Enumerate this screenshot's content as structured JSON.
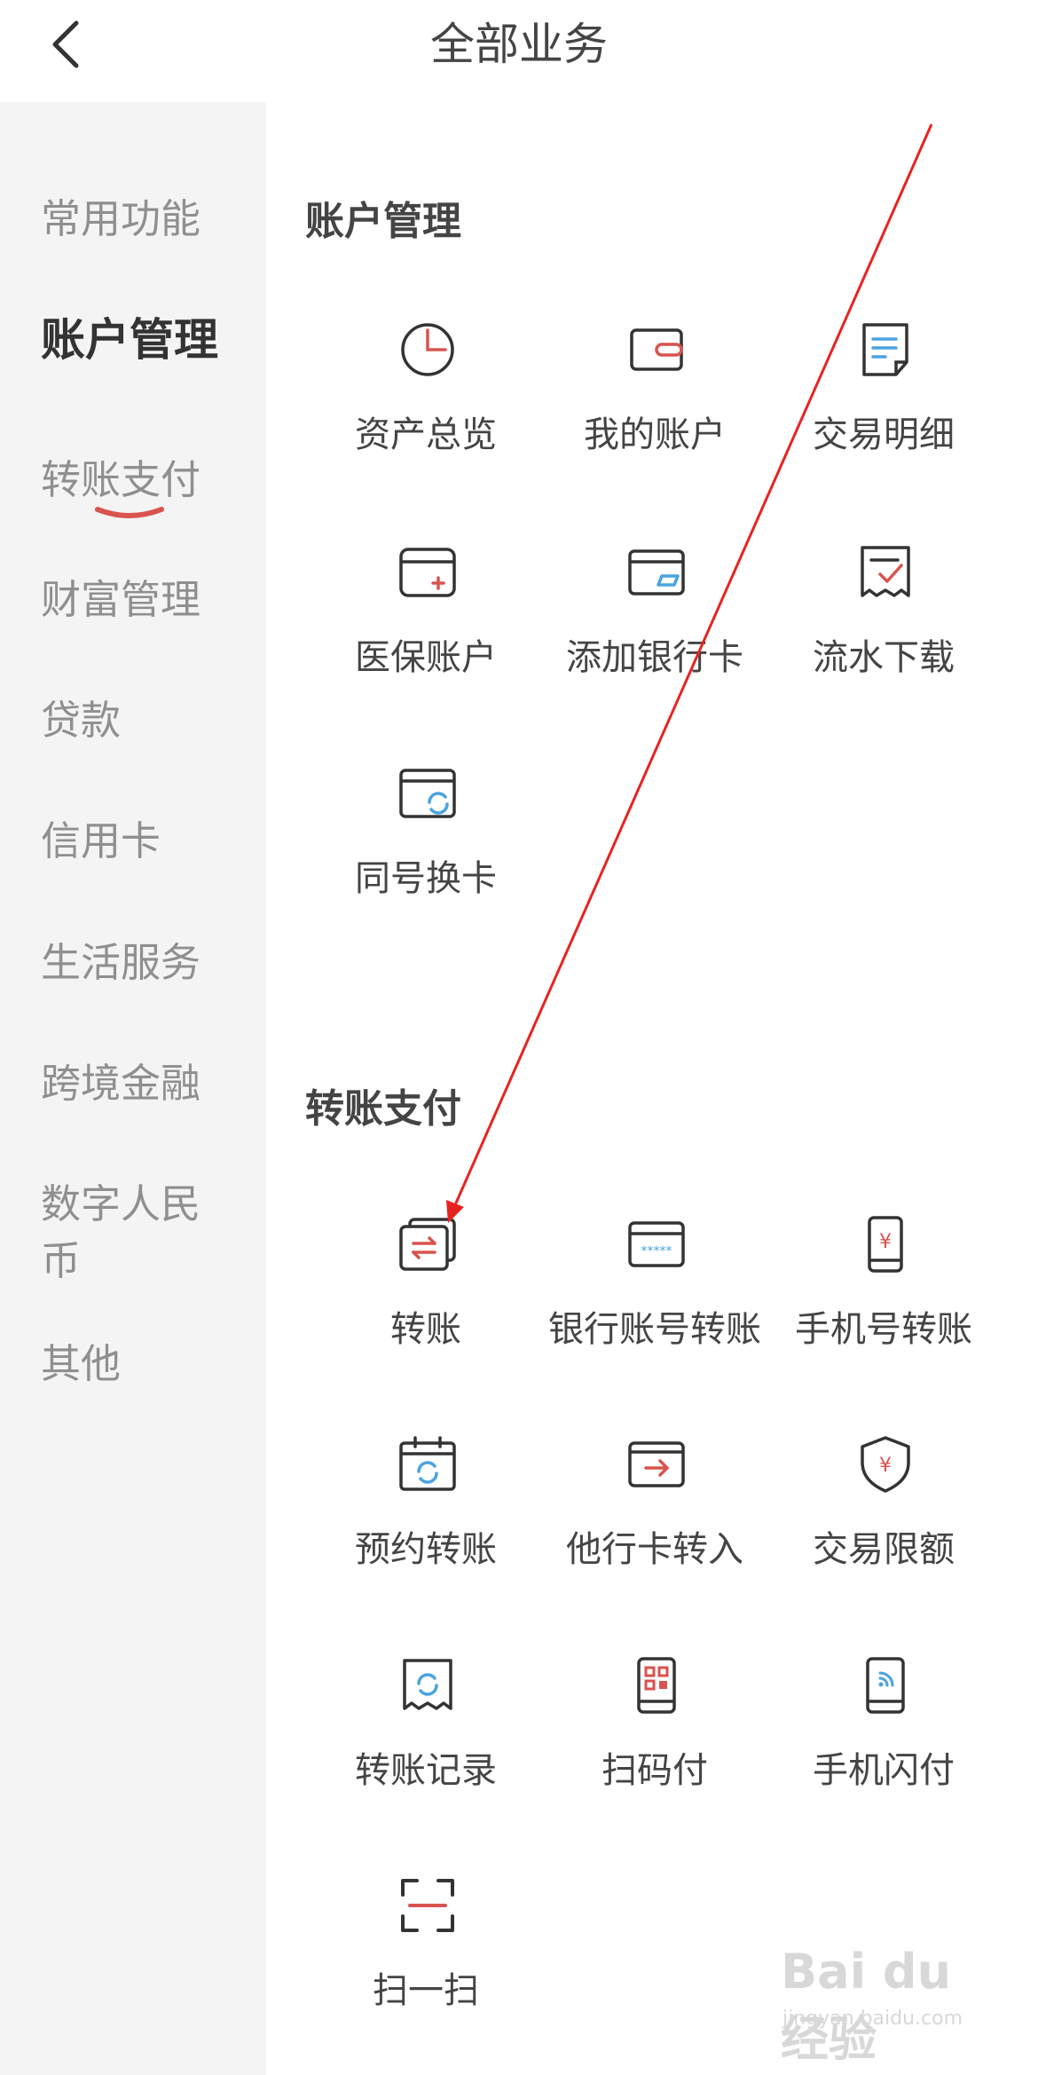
{
  "header": {
    "title": "全部业务"
  },
  "sidebar": {
    "items": [
      {
        "label": "常用功能"
      },
      {
        "label": "账户管理"
      },
      {
        "label": "转账支付"
      },
      {
        "label": "财富管理"
      },
      {
        "label": "贷款"
      },
      {
        "label": "信用卡"
      },
      {
        "label": "生活服务"
      },
      {
        "label": "跨境金融"
      },
      {
        "label": "数字人民币"
      },
      {
        "label": "其他"
      }
    ]
  },
  "sections": [
    {
      "title": "账户管理",
      "tiles": [
        {
          "label": "资产总览",
          "icon": "pie-chart-icon"
        },
        {
          "label": "我的账户",
          "icon": "wallet-icon"
        },
        {
          "label": "交易明细",
          "icon": "document-icon"
        },
        {
          "label": "医保账户",
          "icon": "medical-card-icon"
        },
        {
          "label": "添加银行卡",
          "icon": "add-card-icon"
        },
        {
          "label": "流水下载",
          "icon": "receipt-check-icon"
        },
        {
          "label": "同号换卡",
          "icon": "card-refresh-icon"
        }
      ]
    },
    {
      "title": "转账支付",
      "tiles": [
        {
          "label": "转账",
          "icon": "transfer-cards-icon"
        },
        {
          "label": "银行账号转账",
          "icon": "card-number-icon"
        },
        {
          "label": "手机号转账",
          "icon": "phone-yuan-icon"
        },
        {
          "label": "预约转账",
          "icon": "calendar-refresh-icon"
        },
        {
          "label": "他行卡转入",
          "icon": "card-arrow-in-icon"
        },
        {
          "label": "交易限额",
          "icon": "shield-yuan-icon"
        },
        {
          "label": "转账记录",
          "icon": "receipt-refresh-icon"
        },
        {
          "label": "扫码付",
          "icon": "phone-qr-icon"
        },
        {
          "label": "手机闪付",
          "icon": "phone-nfc-icon"
        },
        {
          "label": "扫一扫",
          "icon": "scan-icon"
        }
      ]
    }
  ],
  "watermark": {
    "brand": "Bai du 经验",
    "url": "jingyan.baidu.com"
  },
  "colors": {
    "accent": "#d9534f",
    "arrow": "#e8231f",
    "sidebar_bg": "#f4f4f4"
  }
}
